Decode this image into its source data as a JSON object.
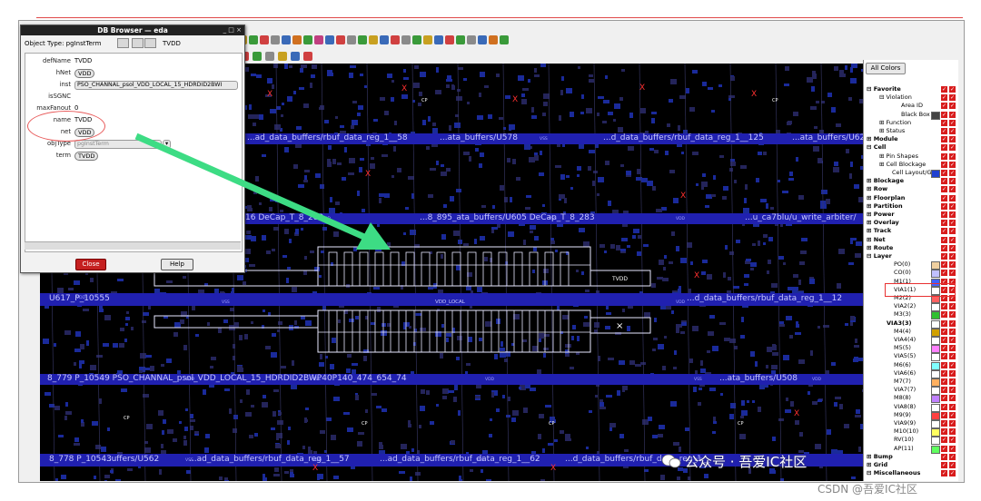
{
  "db_browser": {
    "title": "DB Browser — eda",
    "title_buttons": "_ □ ×",
    "object_type_label": "Object Type: pgInstTerm",
    "object_type_value": "TVDD",
    "fields": {
      "defName": {
        "label": "defName",
        "value": "TVDD"
      },
      "hNet": {
        "label": "hNet",
        "value": "VDD"
      },
      "inst": {
        "label": "inst",
        "value": "PSO_CHANNAL_psol_VDD_LOCAL_15_HDRDID2BWI"
      },
      "isSGNC": {
        "label": "isSGNC",
        "value": ""
      },
      "maxFanout": {
        "label": "maxFanout",
        "value": "0"
      },
      "name": {
        "label": "name",
        "value": "TVDD"
      },
      "net": {
        "label": "net",
        "value": "VDD"
      },
      "objType": {
        "label": "objType",
        "value": "pgInstTerm"
      },
      "term": {
        "label": "term",
        "value": "TVDD"
      }
    },
    "close_label": "Close",
    "help_label": "Help"
  },
  "layer_panel": {
    "all_colors_label": "All Colors",
    "rows": [
      {
        "label": "⊟ Favorite",
        "hdr": true,
        "indent": 0
      },
      {
        "label": "⊟ Violation",
        "hdr": false,
        "indent": 14
      },
      {
        "label": "Area ID",
        "hdr": false,
        "indent": 38
      },
      {
        "label": "Black Box",
        "hdr": false,
        "indent": 38,
        "swatch": "#444444"
      },
      {
        "label": "⊞ Function",
        "hdr": false,
        "indent": 14
      },
      {
        "label": "⊞ Status",
        "hdr": false,
        "indent": 14
      },
      {
        "label": "⊞ Module",
        "hdr": true,
        "indent": 0
      },
      {
        "label": "⊟ Cell",
        "hdr": true,
        "indent": 0
      },
      {
        "label": "⊞ Pin Shapes",
        "hdr": false,
        "indent": 14
      },
      {
        "label": "⊞ Cell Blockage",
        "hdr": false,
        "indent": 14
      },
      {
        "label": "Cell Layout/GI",
        "hdr": false,
        "indent": 28,
        "swatch": "#2040d0"
      },
      {
        "label": "⊞ Blockage",
        "hdr": true,
        "indent": 0
      },
      {
        "label": "⊞ Row",
        "hdr": true,
        "indent": 0
      },
      {
        "label": "⊞ Floorplan",
        "hdr": true,
        "indent": 0
      },
      {
        "label": "⊞ Partition",
        "hdr": true,
        "indent": 0
      },
      {
        "label": "⊞ Power",
        "hdr": true,
        "indent": 0
      },
      {
        "label": "⊞ Overlay",
        "hdr": true,
        "indent": 0
      },
      {
        "label": "⊞ Track",
        "hdr": true,
        "indent": 0
      },
      {
        "label": "⊞ Net",
        "hdr": true,
        "indent": 0
      },
      {
        "label": "⊞ Route",
        "hdr": true,
        "indent": 0
      },
      {
        "label": "⊟ Layer",
        "hdr": true,
        "indent": 0
      },
      {
        "label": "PO(0)",
        "hdr": false,
        "indent": 30,
        "swatch": "#f0d0a0"
      },
      {
        "label": "CO(0)",
        "hdr": false,
        "indent": 30,
        "swatch": "#c0c0ff"
      },
      {
        "label": "M1(1)",
        "hdr": false,
        "indent": 30,
        "swatch": "#4060ff"
      },
      {
        "label": "VIA1(1)",
        "hdr": false,
        "indent": 30,
        "swatch": "#ffffff"
      },
      {
        "label": "M2(2)",
        "hdr": false,
        "indent": 30,
        "swatch": "#ff6060"
      },
      {
        "label": "VIA2(2)",
        "hdr": false,
        "indent": 30,
        "swatch": "#ffffff"
      },
      {
        "label": "M3(3)",
        "hdr": false,
        "indent": 30,
        "swatch": "#30c030"
      },
      {
        "label": "VIA3(3)",
        "hdr": true,
        "indent": 22,
        "swatch": "#ffffff"
      },
      {
        "label": "M4(4)",
        "hdr": false,
        "indent": 30,
        "swatch": "#d0a000"
      },
      {
        "label": "VIA4(4)",
        "hdr": false,
        "indent": 30,
        "swatch": "#ffffff"
      },
      {
        "label": "M5(5)",
        "hdr": false,
        "indent": 30,
        "swatch": "#ff80ff"
      },
      {
        "label": "VIA5(5)",
        "hdr": false,
        "indent": 30,
        "swatch": "#ffffff"
      },
      {
        "label": "M6(6)",
        "hdr": false,
        "indent": 30,
        "swatch": "#80ffff"
      },
      {
        "label": "VIA6(6)",
        "hdr": false,
        "indent": 30,
        "swatch": "#ffffff"
      },
      {
        "label": "M7(7)",
        "hdr": false,
        "indent": 30,
        "swatch": "#ffb060"
      },
      {
        "label": "VIA7(7)",
        "hdr": false,
        "indent": 30,
        "swatch": "#ffffff"
      },
      {
        "label": "M8(8)",
        "hdr": false,
        "indent": 30,
        "swatch": "#c080ff"
      },
      {
        "label": "VIA8(8)",
        "hdr": false,
        "indent": 30,
        "swatch": "#ffffff"
      },
      {
        "label": "M9(9)",
        "hdr": false,
        "indent": 30,
        "swatch": "#ff4040"
      },
      {
        "label": "VIA9(9)",
        "hdr": false,
        "indent": 30,
        "swatch": "#ffffff"
      },
      {
        "label": "M10(10)",
        "hdr": false,
        "indent": 30,
        "swatch": "#ffff60"
      },
      {
        "label": "RV(10)",
        "hdr": false,
        "indent": 30,
        "swatch": "#ffffff"
      },
      {
        "label": "AP(11)",
        "hdr": false,
        "indent": 30,
        "swatch": "#60ff60"
      },
      {
        "label": "⊞ Bump",
        "hdr": true,
        "indent": 0
      },
      {
        "label": "⊞ Grid",
        "hdr": true,
        "indent": 0
      },
      {
        "label": "⊟ Miscellaneous",
        "hdr": true,
        "indent": 0
      }
    ]
  },
  "canvas": {
    "net_labels": [
      "...ad_data_buffers/rbuf_data_reg_1__58",
      "...ata_buffers/U578",
      "...d_data_buffers/rbuf_data_reg_1__125",
      "...ata_buffers/U622",
      "16 DeCap_T_8_282",
      "...8_895_ata_buffers/U605 DeCap_T_8_283",
      "...u_ca7blu/u_write_arbiter/",
      "U617_P_10555",
      "VDD_LOCAL",
      "...d_data_buffers/rbuf_data_reg_1__12",
      "8_779 P_10549 PSO_CHANNAL_psol_VDD_LOCAL_15_HDRDID2BWP40P140_474_654_74",
      "...ata_buffers/U508",
      "8_778 P_10543",
      "...uffers/U562",
      "...ad_data_buffers/rbuf_data_reg_1__57",
      "...ad_data_buffers/rbuf_data_reg_1__62",
      "...d_data_buffers/rbuf_data_reg_1__"
    ],
    "small_labels": [
      "VDD",
      "VSS",
      "VDD_LOCAL"
    ],
    "cell_label": "TVDD",
    "cross_marker": "×",
    "cp_label": "CP"
  },
  "watermarks": {
    "wechat": "公众号 · 吾爱IC社区",
    "csdn": "CSDN @吾爱IC社区"
  },
  "colors": {
    "canvas_bg": "#000000",
    "rail_blue": "#2020b0",
    "rail_text": "#c8c8ff",
    "arrow_green": "#3ddc84",
    "highlight_red": "#e85a5a",
    "close_red": "#c52020"
  }
}
